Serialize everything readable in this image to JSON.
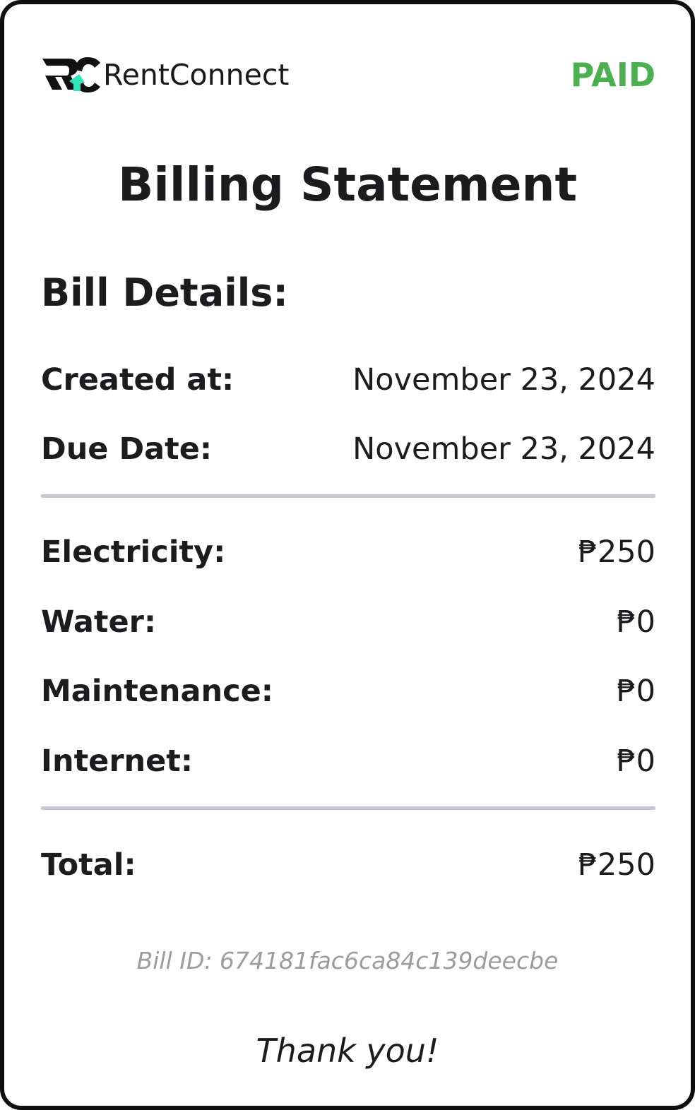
{
  "header": {
    "brand_name": "RentConnect",
    "status": "PAID",
    "status_color": "#4caf50",
    "brand_accent_color": "#2ee6b8",
    "logo_icon": "rc-monogram-logo"
  },
  "title": "Billing Statement",
  "details": {
    "heading": "Bill Details:",
    "created_label": "Created at:",
    "created_value": "November 23, 2024",
    "due_label": "Due Date:",
    "due_value": "November 23, 2024"
  },
  "charges": [
    {
      "label": "Electricity:",
      "amount": "₱250"
    },
    {
      "label": "Water:",
      "amount": "₱0"
    },
    {
      "label": "Maintenance:",
      "amount": "₱0"
    },
    {
      "label": "Internet:",
      "amount": "₱0"
    }
  ],
  "total": {
    "label": "Total:",
    "amount": "₱250"
  },
  "footer": {
    "bill_id": "Bill ID: 674181fac6ca84c139deecbe",
    "thanks": "Thank you!"
  }
}
